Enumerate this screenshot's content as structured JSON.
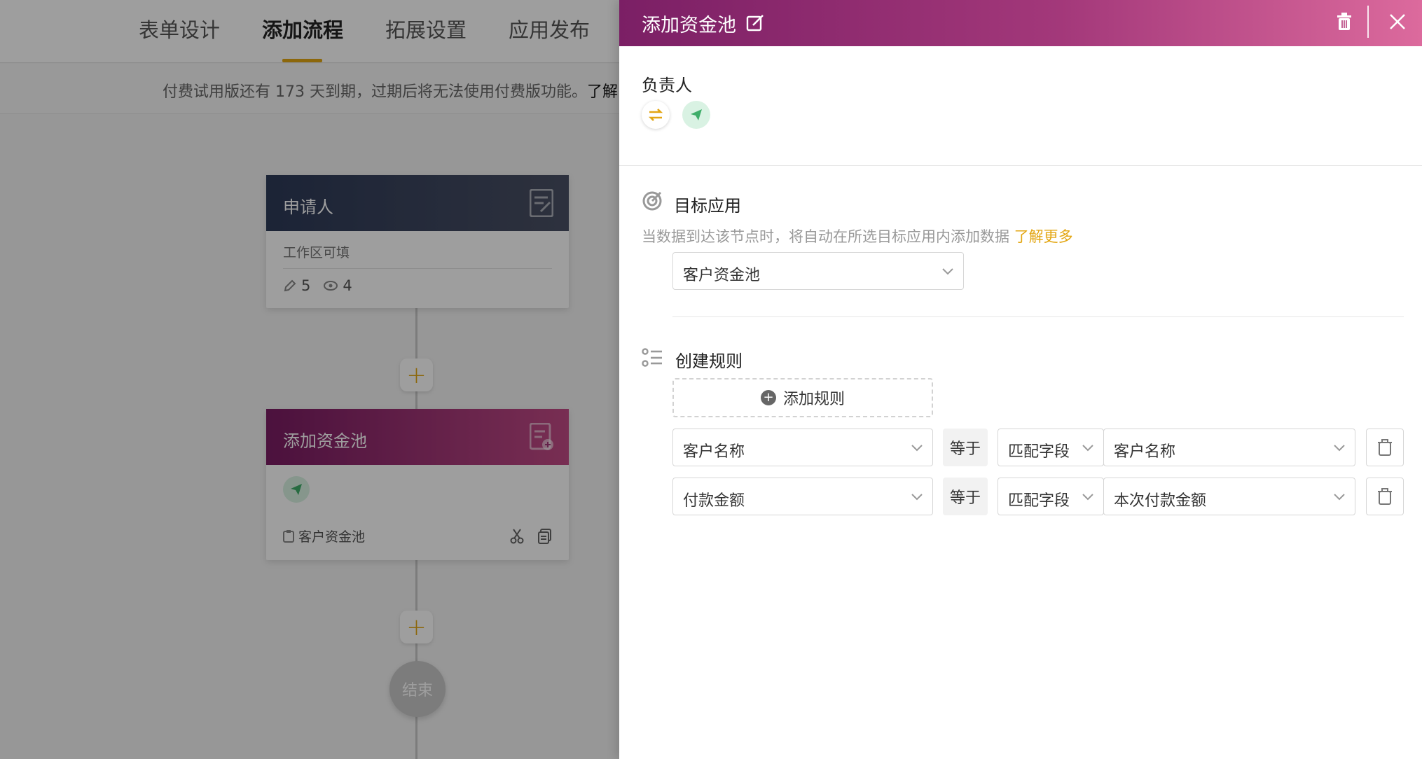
{
  "nav": {
    "tabs": [
      {
        "label": "表单设计"
      },
      {
        "label": "添加流程"
      },
      {
        "label": "拓展设置"
      },
      {
        "label": "应用发布"
      }
    ],
    "active_tab": "添加流程"
  },
  "trial": {
    "text": "付费试用版还有 173 天到期，过期后将无法使用付费版功能。",
    "link": "了解"
  },
  "flow": {
    "applicant_node": {
      "title": "申请人",
      "subtitle": "工作区可填",
      "edit_count": "5",
      "view_count": "4"
    },
    "add_pool_node": {
      "title": "添加资金池",
      "target": "客户资金池"
    },
    "end_label": "结束"
  },
  "drawer": {
    "title": "添加资金池",
    "owner_label": "负责人",
    "target_app": {
      "label": "目标应用",
      "description": "当数据到达该节点时，将自动在所选目标应用内添加数据",
      "learn_more": "了解更多",
      "selected": "客户资金池"
    },
    "rules": {
      "label": "创建规则",
      "add_button": "添加规则",
      "items": [
        {
          "field": "客户名称",
          "operator": "等于",
          "match_type": "匹配字段",
          "value": "客户名称"
        },
        {
          "field": "付款金额",
          "operator": "等于",
          "match_type": "匹配字段",
          "value": "本次付款金额"
        }
      ]
    }
  },
  "colors": {
    "accent": "#e3a612",
    "drawer_header_start": "#7b1f65",
    "drawer_header_end": "#dc6a9d",
    "applicant_header": "#2d3a58",
    "send_green": "#3fae6a"
  }
}
